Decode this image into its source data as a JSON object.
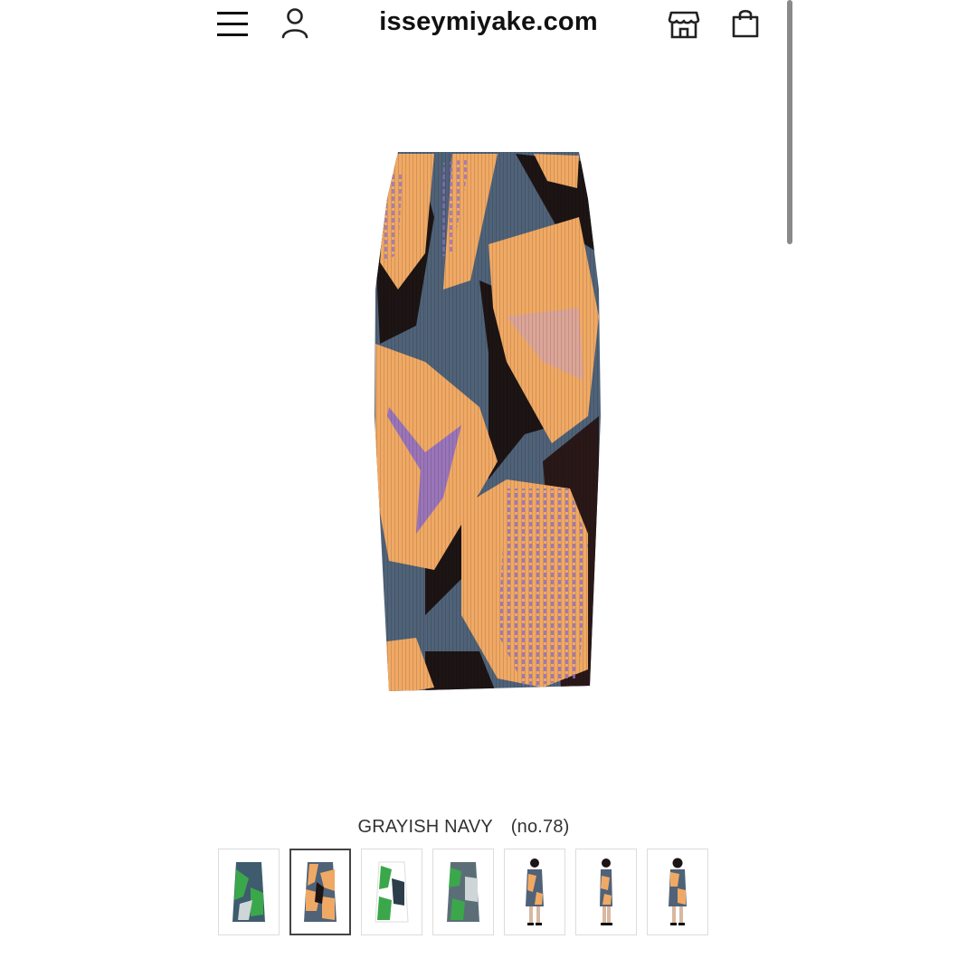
{
  "header": {
    "site_title": "isseymiyake.com",
    "icons": {
      "menu": "hamburger-menu-icon",
      "account": "user-account-icon",
      "store": "store-icon",
      "bag": "shopping-bag-icon"
    }
  },
  "product": {
    "image_alt": "pleated skirt with abstract pattern",
    "color_label": "GRAYISH NAVY　(no.78)",
    "colors": {
      "navy": "#4f6278",
      "orange": "#f0a964",
      "black": "#1d1414",
      "purple": "#8b6cc8",
      "green": "#3aa84a"
    }
  },
  "thumbnails": [
    {
      "name": "green skirt flat front",
      "selected": false
    },
    {
      "name": "grayish navy skirt flat front",
      "selected": true
    },
    {
      "name": "green skirt flat alt",
      "selected": false
    },
    {
      "name": "green skirt flat back",
      "selected": false
    },
    {
      "name": "model front",
      "selected": false
    },
    {
      "name": "model side",
      "selected": false
    },
    {
      "name": "model back",
      "selected": false
    }
  ]
}
